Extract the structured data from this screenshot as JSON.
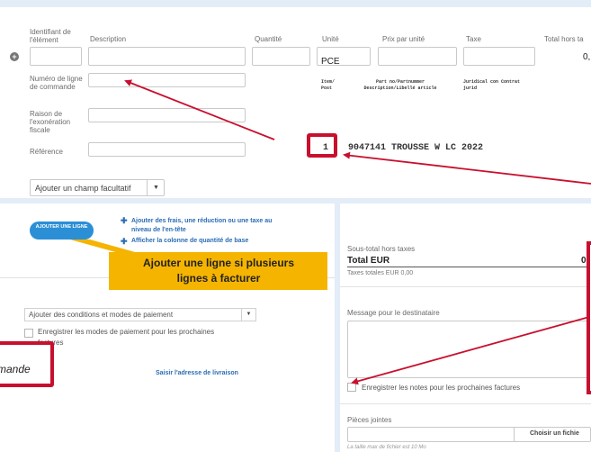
{
  "items_section": {
    "headers": {
      "item_id": "Identifiant de l'élément",
      "description": "Description",
      "quantity": "Quantité",
      "unit": "Unité",
      "unit_price": "Prix par unité",
      "tax": "Taxe",
      "total": "Total hors ta"
    },
    "unit_value": "PCE",
    "total_value": "0,",
    "order_line_label": "Numéro de ligne de commande",
    "exemption_label": "Raison de l'exonération fiscale",
    "reference_label": "Référence",
    "optional_field_label": "Ajouter un champ facultatif",
    "doc_header": {
      "col1": "Item/ Post",
      "col2": "Part no/Partnummer Description/Libellé article",
      "col3": "Juridical con Contrat jurid"
    },
    "doc_line": {
      "number": "1",
      "rest": "9047141 TROUSSE W LC 2022"
    }
  },
  "lines_section": {
    "add_line_button": "AJOUTER UNE LIGNE",
    "link_fees": "Ajouter des frais, une réduction ou une taxe au niveau de l'en-tête",
    "link_base_qty": "Afficher la colonne de quantité de base",
    "callout": "Ajouter une ligne si plusieurs lignes à facturer",
    "payment_select": "Ajouter des conditions et modes de paiement",
    "save_payment_label": "Enregistrer les modes de paiement pour les prochaines factures",
    "left_note": "mande",
    "shipping_link": "Saisir l'adresse de livraison"
  },
  "summary": {
    "subtotal_label": "Sous-total hors taxes",
    "total_label": "Total EUR",
    "total_value": "0",
    "taxes_label": "Taxes totales EUR 0,00"
  },
  "message": {
    "label": "Message pour le destinataire",
    "save_notes_label": "Enregistrer les notes pour les prochaines factures"
  },
  "attachments": {
    "label": "Pièces jointes",
    "choose_file": "Choisir un fichie",
    "size_limit": "La taille max de fichier est 10 Mo"
  },
  "colors": {
    "annotation_red": "#c8102e",
    "callout_yellow": "#f5b400",
    "button_blue": "#2b8fd6",
    "link_blue": "#2a6db5"
  }
}
